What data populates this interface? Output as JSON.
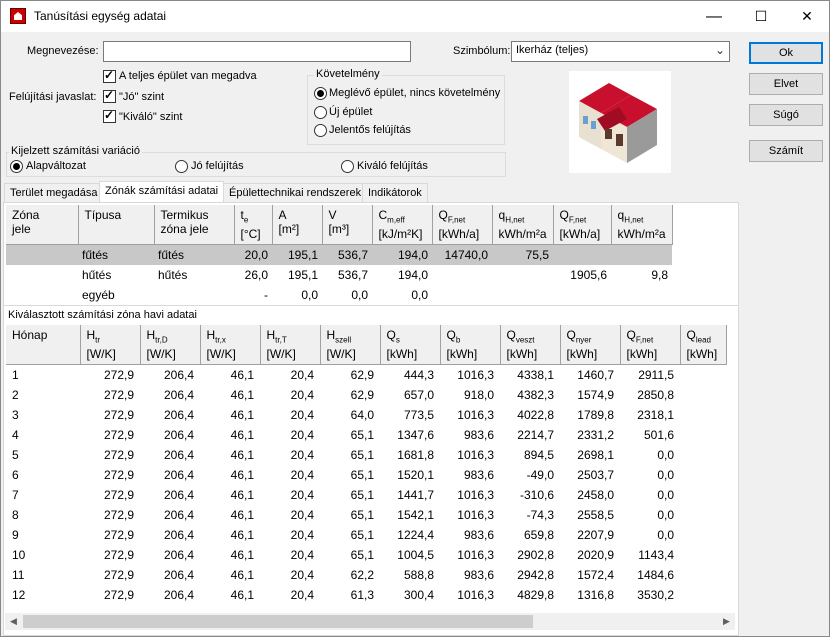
{
  "window": {
    "title": "Tanúsítási egység adatai",
    "minimize": "—",
    "maximize": "☐",
    "close": "✕"
  },
  "form": {
    "megnevezes_label": "Megnevezése:",
    "megnevezes_value": "",
    "szimbolum_label": "Szimbólum:",
    "szimbolum_value": "Ikerház (teljes)",
    "teljes_epulet": "A teljes épület van megadva",
    "felujitasi_label": "Felújítási javaslat:",
    "jo_szint": "\"Jó\" szint",
    "kivalo_szint": "\"Kiváló\" szint",
    "kovetelmeny_title": "Követelmény",
    "kov_opts": [
      "Meglévő épület, nincs követelmény",
      "Új épület",
      "Jelentős felújítás"
    ],
    "variacio_title": "Kijelzett számítási variáció",
    "var_opts": [
      "Alapváltozat",
      "Jó felújítás",
      "Kiváló felújítás"
    ]
  },
  "buttons": {
    "ok": "Ok",
    "elvet": "Elvet",
    "sugo": "Súgó",
    "szamit": "Számít"
  },
  "tabs": [
    "Terület megadása",
    "Zónák számítási adatai",
    "Épülettechnikai rendszerek",
    "Indikátorok"
  ],
  "zones": {
    "headers": [
      [
        "Zóna",
        "jele"
      ],
      [
        "Típusa",
        ""
      ],
      [
        "Termikus",
        "zóna jele"
      ],
      [
        "t",
        "[°C]"
      ],
      [
        "A",
        "[m²]"
      ],
      [
        "V",
        "[m³]"
      ],
      [
        "C",
        "[kJ/m²K]"
      ],
      [
        "Q",
        "[kWh/a]"
      ],
      [
        "q",
        "kWh/m²a"
      ],
      [
        "Q",
        "[kWh/a]"
      ],
      [
        "q",
        "kWh/m²a"
      ]
    ],
    "subs": [
      "",
      "",
      "",
      "e",
      "",
      "",
      "m,eff",
      "F,net",
      "H,net",
      "F,net",
      "H,net"
    ],
    "rows": [
      [
        "",
        "fűtés",
        "fűtés",
        "20,0",
        "195,1",
        "536,7",
        "194,0",
        "14740,0",
        "75,5",
        "",
        ""
      ],
      [
        "",
        "hűtés",
        "hűtés",
        "26,0",
        "195,1",
        "536,7",
        "194,0",
        "",
        "",
        "1905,6",
        "9,8"
      ],
      [
        "",
        "egyéb",
        "",
        "-",
        "0,0",
        "0,0",
        "0,0",
        "",
        "",
        "",
        ""
      ]
    ]
  },
  "monthly": {
    "title": "Kiválasztott számítási zóna havi adatai",
    "headers": [
      [
        "Hónap",
        ""
      ],
      [
        "H",
        "[W/K]"
      ],
      [
        "H",
        "[W/K]"
      ],
      [
        "H",
        "[W/K]"
      ],
      [
        "H",
        "[W/K]"
      ],
      [
        "H",
        "[W/K]"
      ],
      [
        "Q",
        "[kWh]"
      ],
      [
        "Q",
        "[kWh]"
      ],
      [
        "Q",
        "[kWh]"
      ],
      [
        "Q",
        "[kWh]"
      ],
      [
        "Q",
        "[kWh]"
      ],
      [
        "Q",
        "[kWh]"
      ]
    ],
    "subs": [
      "",
      "tr",
      "tr,D",
      "tr,x",
      "tr,T",
      "szell",
      "s",
      "b",
      "veszt",
      "nyer",
      "F,net",
      "lead"
    ],
    "rows": [
      [
        "1",
        "272,9",
        "206,4",
        "46,1",
        "20,4",
        "62,9",
        "444,3",
        "1016,3",
        "4338,1",
        "1460,7",
        "2911,5"
      ],
      [
        "2",
        "272,9",
        "206,4",
        "46,1",
        "20,4",
        "62,9",
        "657,0",
        "918,0",
        "4382,3",
        "1574,9",
        "2850,8"
      ],
      [
        "3",
        "272,9",
        "206,4",
        "46,1",
        "20,4",
        "64,0",
        "773,5",
        "1016,3",
        "4022,8",
        "1789,8",
        "2318,1"
      ],
      [
        "4",
        "272,9",
        "206,4",
        "46,1",
        "20,4",
        "65,1",
        "1347,6",
        "983,6",
        "2214,7",
        "2331,2",
        "501,6"
      ],
      [
        "5",
        "272,9",
        "206,4",
        "46,1",
        "20,4",
        "65,1",
        "1681,8",
        "1016,3",
        "894,5",
        "2698,1",
        "0,0"
      ],
      [
        "6",
        "272,9",
        "206,4",
        "46,1",
        "20,4",
        "65,1",
        "1520,1",
        "983,6",
        "-49,0",
        "2503,7",
        "0,0"
      ],
      [
        "7",
        "272,9",
        "206,4",
        "46,1",
        "20,4",
        "65,1",
        "1441,7",
        "1016,3",
        "-310,6",
        "2458,0",
        "0,0"
      ],
      [
        "8",
        "272,9",
        "206,4",
        "46,1",
        "20,4",
        "65,1",
        "1542,1",
        "1016,3",
        "-74,3",
        "2558,5",
        "0,0"
      ],
      [
        "9",
        "272,9",
        "206,4",
        "46,1",
        "20,4",
        "65,1",
        "1224,4",
        "983,6",
        "659,8",
        "2207,9",
        "0,0"
      ],
      [
        "10",
        "272,9",
        "206,4",
        "46,1",
        "20,4",
        "65,1",
        "1004,5",
        "1016,3",
        "2902,8",
        "2020,9",
        "1143,4"
      ],
      [
        "11",
        "272,9",
        "206,4",
        "46,1",
        "20,4",
        "62,2",
        "588,8",
        "983,6",
        "2942,8",
        "1572,4",
        "1484,6"
      ],
      [
        "12",
        "272,9",
        "206,4",
        "46,1",
        "20,4",
        "61,3",
        "300,4",
        "1016,3",
        "4829,8",
        "1316,8",
        "3530,2"
      ]
    ]
  },
  "colors": {
    "selected_row": "#c8c8c8",
    "accent": "#0078d7",
    "roof": "#c8102e"
  }
}
